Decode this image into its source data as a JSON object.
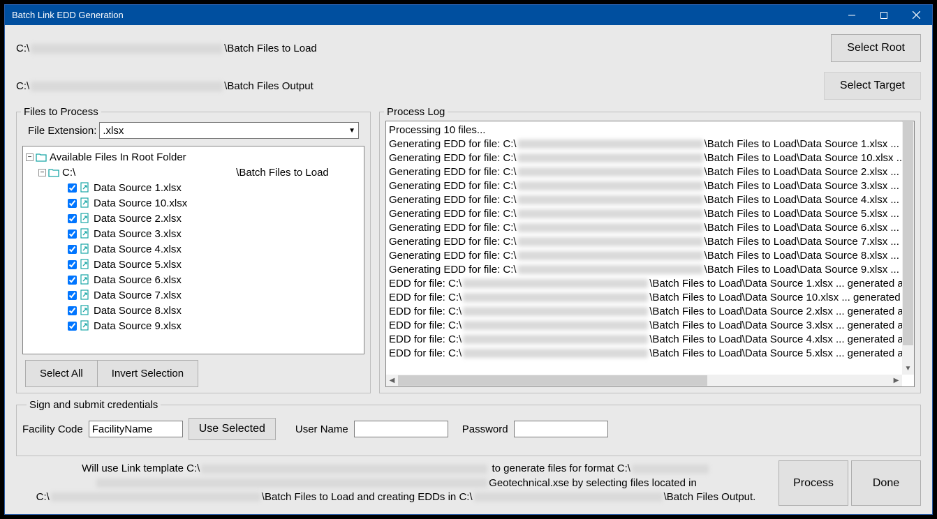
{
  "window": {
    "title": "Batch Link EDD Generation"
  },
  "paths": {
    "root_prefix": "C:\\",
    "root_suffix": "\\Batch Files to Load",
    "target_prefix": "C:\\",
    "target_suffix": "\\Batch Files Output"
  },
  "buttons": {
    "select_root": "Select Root",
    "select_target": "Select Target",
    "select_all": "Select All",
    "invert_selection": "Invert Selection",
    "use_selected": "Use Selected",
    "process": "Process",
    "done": "Done"
  },
  "files_panel": {
    "legend": "Files to Process",
    "ext_label": "File Extension:",
    "ext_value": ".xlsx",
    "tree_root": "Available Files In Root Folder",
    "tree_folder_prefix": "C:\\",
    "tree_folder_suffix": "\\Batch Files to Load",
    "items": [
      "Data Source 1.xlsx",
      "Data Source 10.xlsx",
      "Data Source 2.xlsx",
      "Data Source 3.xlsx",
      "Data Source 4.xlsx",
      "Data Source 5.xlsx",
      "Data Source 6.xlsx",
      "Data Source 7.xlsx",
      "Data Source 8.xlsx",
      "Data Source 9.xlsx"
    ]
  },
  "log_panel": {
    "legend": "Process Log",
    "header": "Processing 10 files...",
    "gen_prefix": "Generating EDD for file: C:\\",
    "gen_mid": "\\Batch Files to Load\\",
    "gen_suffix": " ...",
    "gen_files": [
      "Data Source 1.xlsx",
      "Data Source 10.xlsx",
      "Data Source 2.xlsx",
      "Data Source 3.xlsx",
      "Data Source 4.xlsx",
      "Data Source 5.xlsx",
      "Data Source 6.xlsx",
      "Data Source 7.xlsx",
      "Data Source 8.xlsx",
      "Data Source 9.xlsx"
    ],
    "done_prefix": "EDD for file: C:\\",
    "done_mid": "\\Batch Files to Load\\",
    "done_suffix_a": " ... generated a",
    "done_suffix_b": " ... generated",
    "done_files": [
      "Data Source 1.xlsx",
      "Data Source 10.xlsx",
      "Data Source 2.xlsx",
      "Data Source 3.xlsx",
      "Data Source 4.xlsx",
      "Data Source 5.xlsx"
    ]
  },
  "creds": {
    "legend": "Sign and submit credentials",
    "facility_label": "Facility Code",
    "facility_value": "FacilityName",
    "user_label": "User Name",
    "user_value": "",
    "pass_label": "Password",
    "pass_value": ""
  },
  "summary": {
    "l1a": "Will use Link template C:\\",
    "l1b": " to generate files for format C:\\",
    "l2a": "Geotechnical.xse by selecting files located in",
    "l3a": "C:\\",
    "l3b": "\\Batch Files to Load and creating EDDs in C:\\",
    "l3c": "\\Batch Files Output."
  }
}
